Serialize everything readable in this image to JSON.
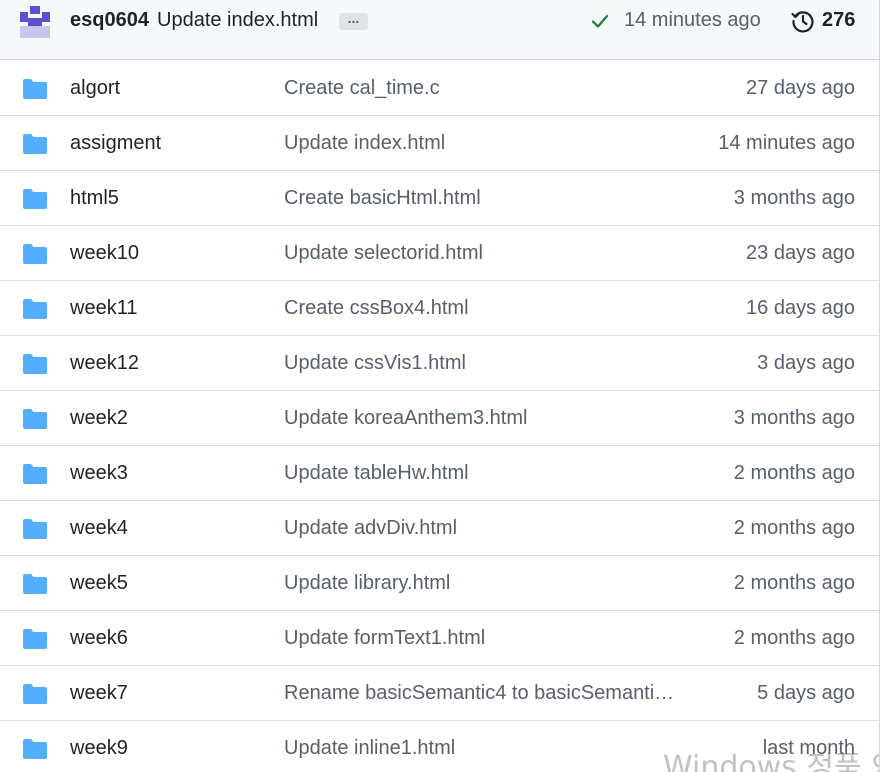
{
  "latest_commit": {
    "author": "esq0604",
    "message": "Update index.html",
    "ellipsis": "...",
    "status": "success",
    "time": "14 minutes ago",
    "commit_count": "276",
    "icons": [
      "avatar",
      "check-icon",
      "history-icon"
    ],
    "colors": {
      "check": "#1a7f37",
      "bar_bg": "#f6f8fa"
    }
  },
  "files": [
    {
      "name": "algort",
      "message": "Create cal_time.c",
      "time": "27 days ago"
    },
    {
      "name": "assigment",
      "message": "Update index.html",
      "time": "14 minutes ago"
    },
    {
      "name": "html5",
      "message": "Create basicHtml.html",
      "time": "3 months ago"
    },
    {
      "name": "week10",
      "message": "Update selectorid.html",
      "time": "23 days ago"
    },
    {
      "name": "week11",
      "message": "Create cssBox4.html",
      "time": "16 days ago"
    },
    {
      "name": "week12",
      "message": "Update cssVis1.html",
      "time": "3 days ago"
    },
    {
      "name": "week2",
      "message": "Update koreaAnthem3.html",
      "time": "3 months ago"
    },
    {
      "name": "week3",
      "message": "Update tableHw.html",
      "time": "2 months ago"
    },
    {
      "name": "week4",
      "message": "Update advDiv.html",
      "time": "2 months ago"
    },
    {
      "name": "week5",
      "message": "Update library.html",
      "time": "2 months ago"
    },
    {
      "name": "week6",
      "message": "Update formText1.html",
      "time": "2 months ago"
    },
    {
      "name": "week7",
      "message": "Rename basicSemantic4 to basicSemanti…",
      "time": "5 days ago"
    },
    {
      "name": "week9",
      "message": "Update inline1.html",
      "time": "last month"
    }
  ],
  "folder_icon_color": "#54aeff",
  "watermark": "Windows 정품 인"
}
